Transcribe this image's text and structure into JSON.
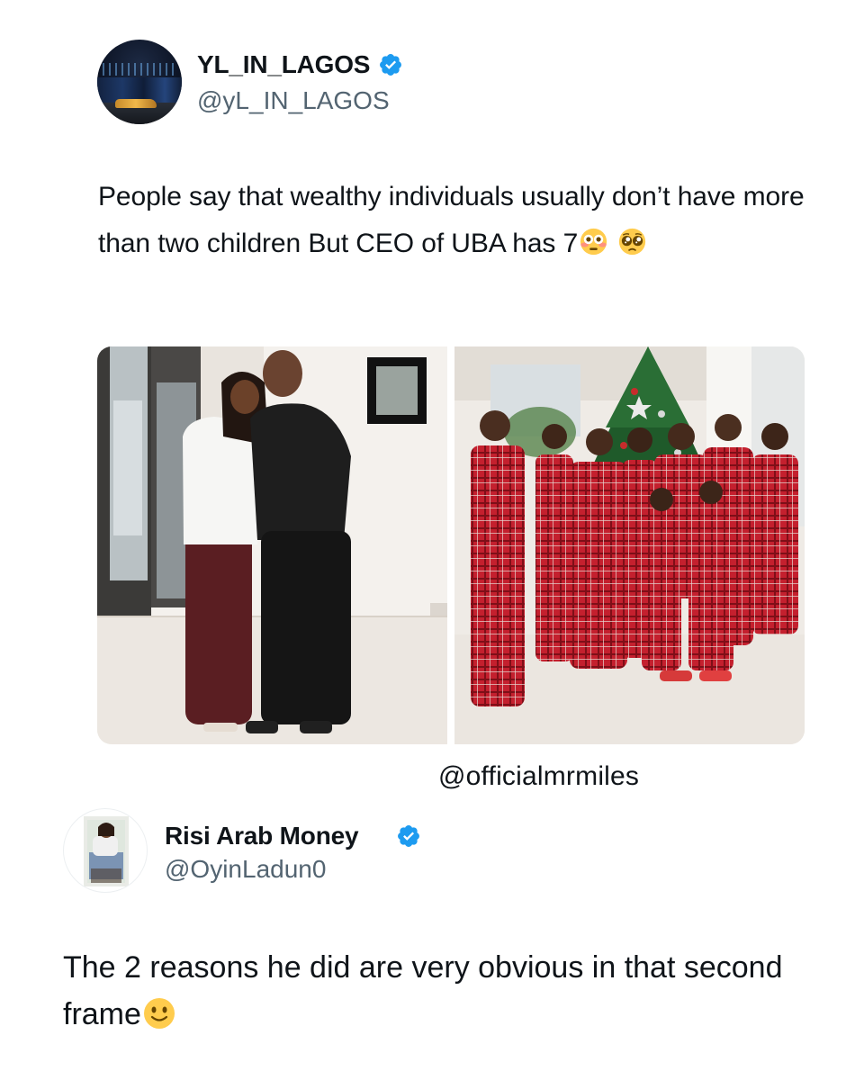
{
  "tweets": [
    {
      "display_name": "YL_IN_LAGOS",
      "handle": "@yL_IN_LAGOS",
      "verified": true,
      "text": "People say that wealthy individuals usually don’t have more than two children But CEO of UBA has 7",
      "emojis": [
        "flushed-face",
        "pleading-face"
      ],
      "media": [
        {
          "name": "couple-photo"
        },
        {
          "name": "family-christmas-photo"
        }
      ]
    },
    {
      "display_name": "Risi Arab Money",
      "handle": "@OyinLadun0",
      "verified": true,
      "text": "The 2 reasons he did are very obvious in that second frame",
      "emojis": [
        "slightly-smiling-face"
      ]
    }
  ],
  "watermark": "@officialmrmiles",
  "colors": {
    "verified_badge": "#1d9bf0",
    "text": "#0f1419",
    "handle": "#536471",
    "pajama_red": "#c4202e"
  }
}
